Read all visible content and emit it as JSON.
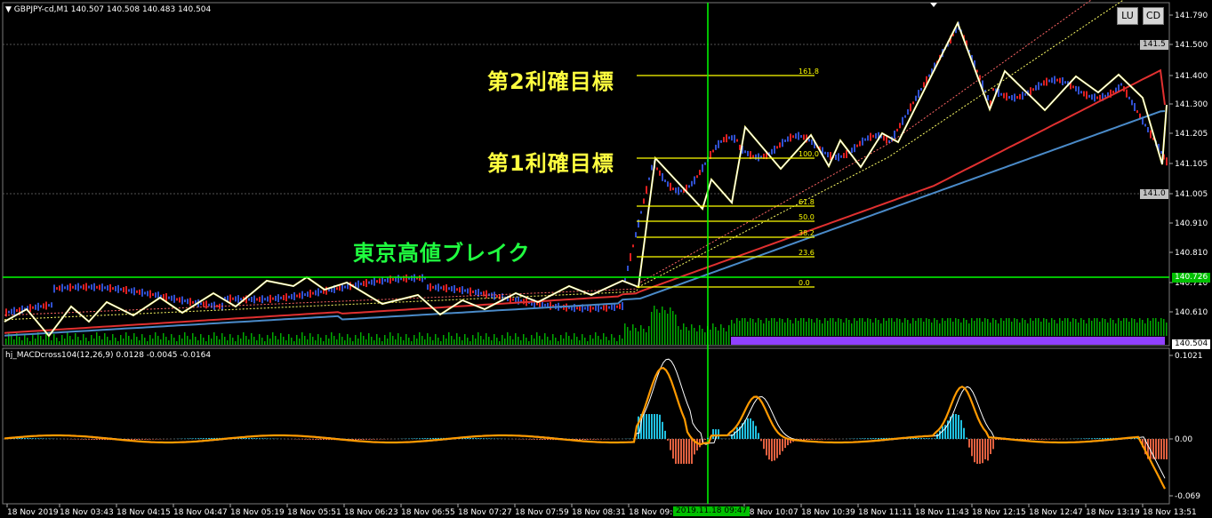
{
  "header": {
    "symbol_info": "GBPJPY-cd,M1  140.507 140.508 140.483 140.504",
    "macd_info": "hj_MACDcross104(12,26,9) 0.0128 -0.0045 -0.0164"
  },
  "buttons": {
    "lu": "LU",
    "cd": "CD"
  },
  "annotations": {
    "target2": "第2利確目標",
    "target1": "第1利確目標",
    "tokyo_break": "東京高値ブレイク"
  },
  "price_axis": {
    "ticks": [
      "141.790",
      "141.500",
      "141.400",
      "141.300",
      "141.205",
      "141.105",
      "141.005",
      "140.910",
      "140.810",
      "140.710",
      "140.610"
    ],
    "badges": {
      "b1415": "141.5",
      "b1410": "141.0",
      "current": "140.504",
      "hline": "140.726"
    }
  },
  "macd_axis": {
    "ticks": [
      "0.1021",
      "0.00",
      "-0.069"
    ]
  },
  "time_axis": {
    "ticks": [
      "18 Nov 2019",
      "18 Nov 03:43",
      "18 Nov 04:15",
      "18 Nov 04:47",
      "18 Nov 05:19",
      "18 Nov 05:51",
      "18 Nov 06:23",
      "18 Nov 06:55",
      "18 Nov 07:27",
      "18 Nov 07:59",
      "18 Nov 08:31",
      "18 Nov 09:03",
      "18 Nov 10:07",
      "18 Nov 10:39",
      "18 Nov 11:11",
      "18 Nov 11:43",
      "18 Nov 12:15",
      "18 Nov 12:47",
      "18 Nov 13:19",
      "18 Nov 13:51"
    ],
    "crosshair": "2019.11.18 09:47"
  },
  "fibonacci": {
    "levels": [
      "161.8",
      "100.0",
      "61.8",
      "50.0",
      "38.2",
      "23.6",
      "0.0"
    ]
  },
  "colors": {
    "background": "#000000",
    "grid": "#606060",
    "zigzag": "#ffffff",
    "fib": "#ffff00",
    "hline": "#00ff00",
    "ma_red": "#e03030",
    "ma_blue": "#4a8ac8",
    "macd_orange": "#ff9a00",
    "volume": "#00aa00",
    "purple": "#9040ff"
  }
}
